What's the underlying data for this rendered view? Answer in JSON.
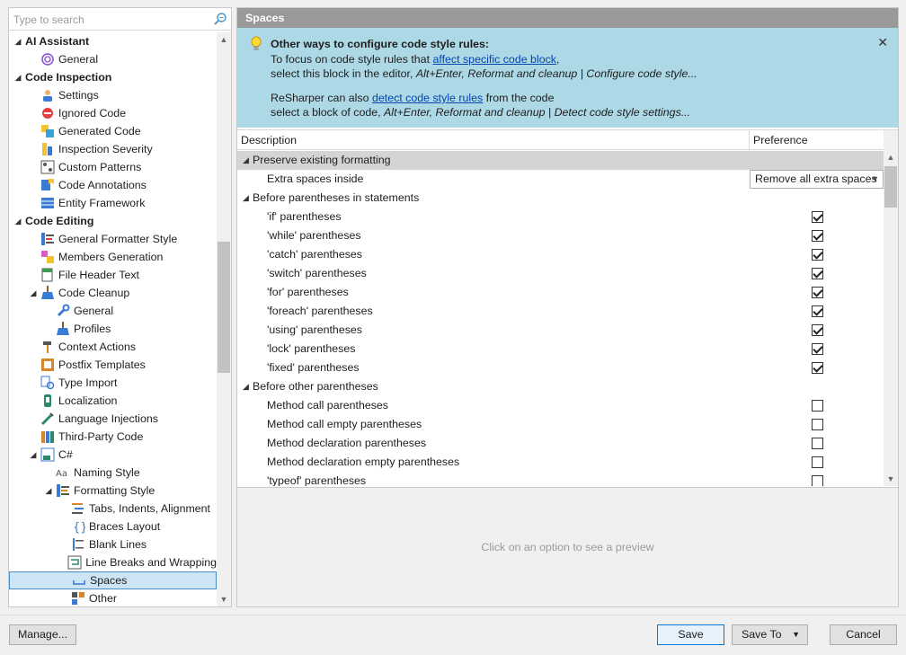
{
  "search": {
    "placeholder": "Type to search"
  },
  "tree": [
    {
      "label": "AI Assistant",
      "level": 0,
      "bold": true,
      "expanded": true,
      "icon": ""
    },
    {
      "label": "General",
      "level": 1,
      "icon": "ai-swirl"
    },
    {
      "label": "Code Inspection",
      "level": 0,
      "bold": true,
      "expanded": true,
      "icon": ""
    },
    {
      "label": "Settings",
      "level": 1,
      "icon": "person"
    },
    {
      "label": "Ignored Code",
      "level": 1,
      "icon": "no-entry"
    },
    {
      "label": "Generated Code",
      "level": 1,
      "icon": "generated"
    },
    {
      "label": "Inspection Severity",
      "level": 1,
      "icon": "severity"
    },
    {
      "label": "Custom Patterns",
      "level": 1,
      "icon": "patterns"
    },
    {
      "label": "Code Annotations",
      "level": 1,
      "icon": "annotations"
    },
    {
      "label": "Entity Framework",
      "level": 1,
      "icon": "entity"
    },
    {
      "label": "Code Editing",
      "level": 0,
      "bold": true,
      "expanded": true,
      "icon": ""
    },
    {
      "label": "General Formatter Style",
      "level": 1,
      "icon": "formatter"
    },
    {
      "label": "Members Generation",
      "level": 1,
      "icon": "members"
    },
    {
      "label": "File Header Text",
      "level": 1,
      "icon": "file-header"
    },
    {
      "label": "Code Cleanup",
      "level": 1,
      "expanded": true,
      "icon": "broom"
    },
    {
      "label": "General",
      "level": 2,
      "icon": "wrench"
    },
    {
      "label": "Profiles",
      "level": 2,
      "icon": "broom"
    },
    {
      "label": "Context Actions",
      "level": 1,
      "icon": "hammer"
    },
    {
      "label": "Postfix Templates",
      "level": 1,
      "icon": "postfix"
    },
    {
      "label": "Type Import",
      "level": 1,
      "icon": "type-import"
    },
    {
      "label": "Localization",
      "level": 1,
      "icon": "localization"
    },
    {
      "label": "Language Injections",
      "level": 1,
      "icon": "syringe"
    },
    {
      "label": "Third-Party Code",
      "level": 1,
      "icon": "books"
    },
    {
      "label": "C#",
      "level": 1,
      "expanded": true,
      "icon": "csharp"
    },
    {
      "label": "Naming Style",
      "level": 2,
      "icon": "naming"
    },
    {
      "label": "Formatting Style",
      "level": 2,
      "expanded": true,
      "icon": "formatting"
    },
    {
      "label": "Tabs, Indents, Alignment",
      "level": 3,
      "icon": "tabs"
    },
    {
      "label": "Braces Layout",
      "level": 3,
      "icon": "braces"
    },
    {
      "label": "Blank Lines",
      "level": 3,
      "icon": "blank-lines"
    },
    {
      "label": "Line Breaks and Wrapping",
      "level": 3,
      "icon": "wrap"
    },
    {
      "label": "Spaces",
      "level": 3,
      "icon": "spaces",
      "selected": true
    },
    {
      "label": "Other",
      "level": 3,
      "icon": "other"
    }
  ],
  "page": {
    "title": "Spaces"
  },
  "info": {
    "heading": "Other ways to configure code style rules:",
    "l1a": "To focus on code style rules that ",
    "l1link": "affect specific code block",
    "l1b": ",",
    "l2a": "select this block in the editor, ",
    "l2i": "Alt+Enter, Reformat and cleanup | Configure code style...",
    "l3a": "ReSharper can also ",
    "l3link": "detect code style rules",
    "l3b": " from the code",
    "l4a": "select a block of code, ",
    "l4i": "Alt+Enter, Reformat and cleanup | Detect code style settings...",
    "close": "✕"
  },
  "table": {
    "col_description": "Description",
    "col_preference": "Preference",
    "rows": [
      {
        "type": "group",
        "label": "Preserve existing formatting",
        "first": true
      },
      {
        "type": "dropdown",
        "label": "Extra spaces inside",
        "value": "Remove all extra spaces"
      },
      {
        "type": "group",
        "label": "Before parentheses in statements"
      },
      {
        "type": "check",
        "label": "'if' parentheses",
        "checked": true
      },
      {
        "type": "check",
        "label": "'while' parentheses",
        "checked": true
      },
      {
        "type": "check",
        "label": "'catch' parentheses",
        "checked": true
      },
      {
        "type": "check",
        "label": "'switch' parentheses",
        "checked": true
      },
      {
        "type": "check",
        "label": "'for' parentheses",
        "checked": true
      },
      {
        "type": "check",
        "label": "'foreach' parentheses",
        "checked": true
      },
      {
        "type": "check",
        "label": "'using' parentheses",
        "checked": true
      },
      {
        "type": "check",
        "label": "'lock' parentheses",
        "checked": true
      },
      {
        "type": "check",
        "label": "'fixed' parentheses",
        "checked": true
      },
      {
        "type": "group",
        "label": "Before other parentheses"
      },
      {
        "type": "check",
        "label": "Method call parentheses",
        "checked": false
      },
      {
        "type": "check",
        "label": "Method call empty parentheses",
        "checked": false
      },
      {
        "type": "check",
        "label": "Method declaration parentheses",
        "checked": false
      },
      {
        "type": "check",
        "label": "Method declaration empty parentheses",
        "checked": false
      },
      {
        "type": "check",
        "label": "'typeof' parentheses",
        "checked": false
      }
    ]
  },
  "preview": {
    "hint": "Click on an option to see a preview"
  },
  "buttons": {
    "manage": "Manage...",
    "save": "Save",
    "save_to": "Save To",
    "cancel": "Cancel"
  },
  "colors": {
    "title_bar": "#999999",
    "info_bg": "#add8e6",
    "selection": "#cce4f3",
    "link": "#0645ad"
  }
}
